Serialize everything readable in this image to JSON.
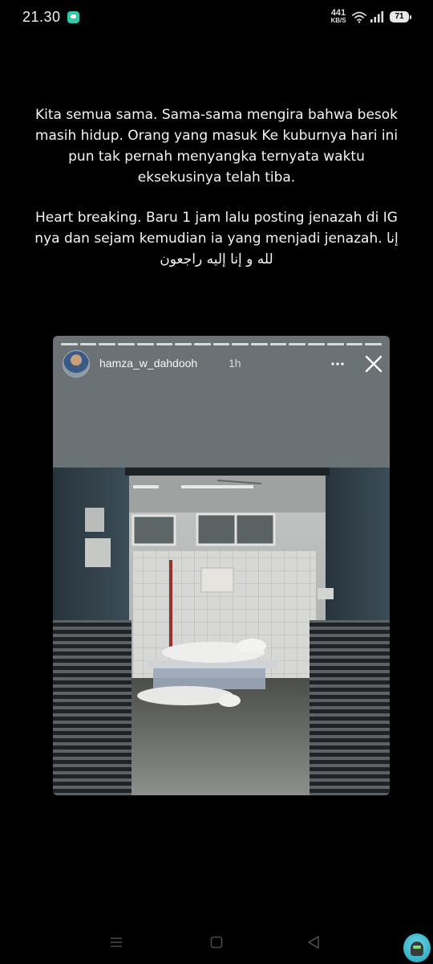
{
  "status_bar": {
    "time": "21.30",
    "network_speed_value": "441",
    "network_speed_unit": "KB/S",
    "battery_level": "71",
    "icons": [
      "message-notification-icon",
      "wifi-icon",
      "signal-icon",
      "battery-icon"
    ]
  },
  "caption": {
    "paragraph_1": "Kita semua sama. Sama-sama mengira bahwa besok masih hidup. Orang yang masuk Ke kuburnya hari ini pun tak pernah menyangka ternyata waktu eksekusinya telah tiba.",
    "paragraph_2": "Heart breaking. Baru 1 jam lalu posting jenazah di IG nya dan sejam kemudian ia yang menjadi jenazah. إنا لله و إنا إليه راجعون"
  },
  "story": {
    "username": "hamza_w_dahdooh",
    "posted_ago": "1h",
    "progress_segments": 17,
    "background_color": "#6b7276",
    "icons": [
      "more-options-icon",
      "close-icon"
    ]
  },
  "nav_bar": {
    "icons": [
      "menu-icon",
      "home-icon",
      "back-icon",
      "assistant-icon"
    ]
  }
}
